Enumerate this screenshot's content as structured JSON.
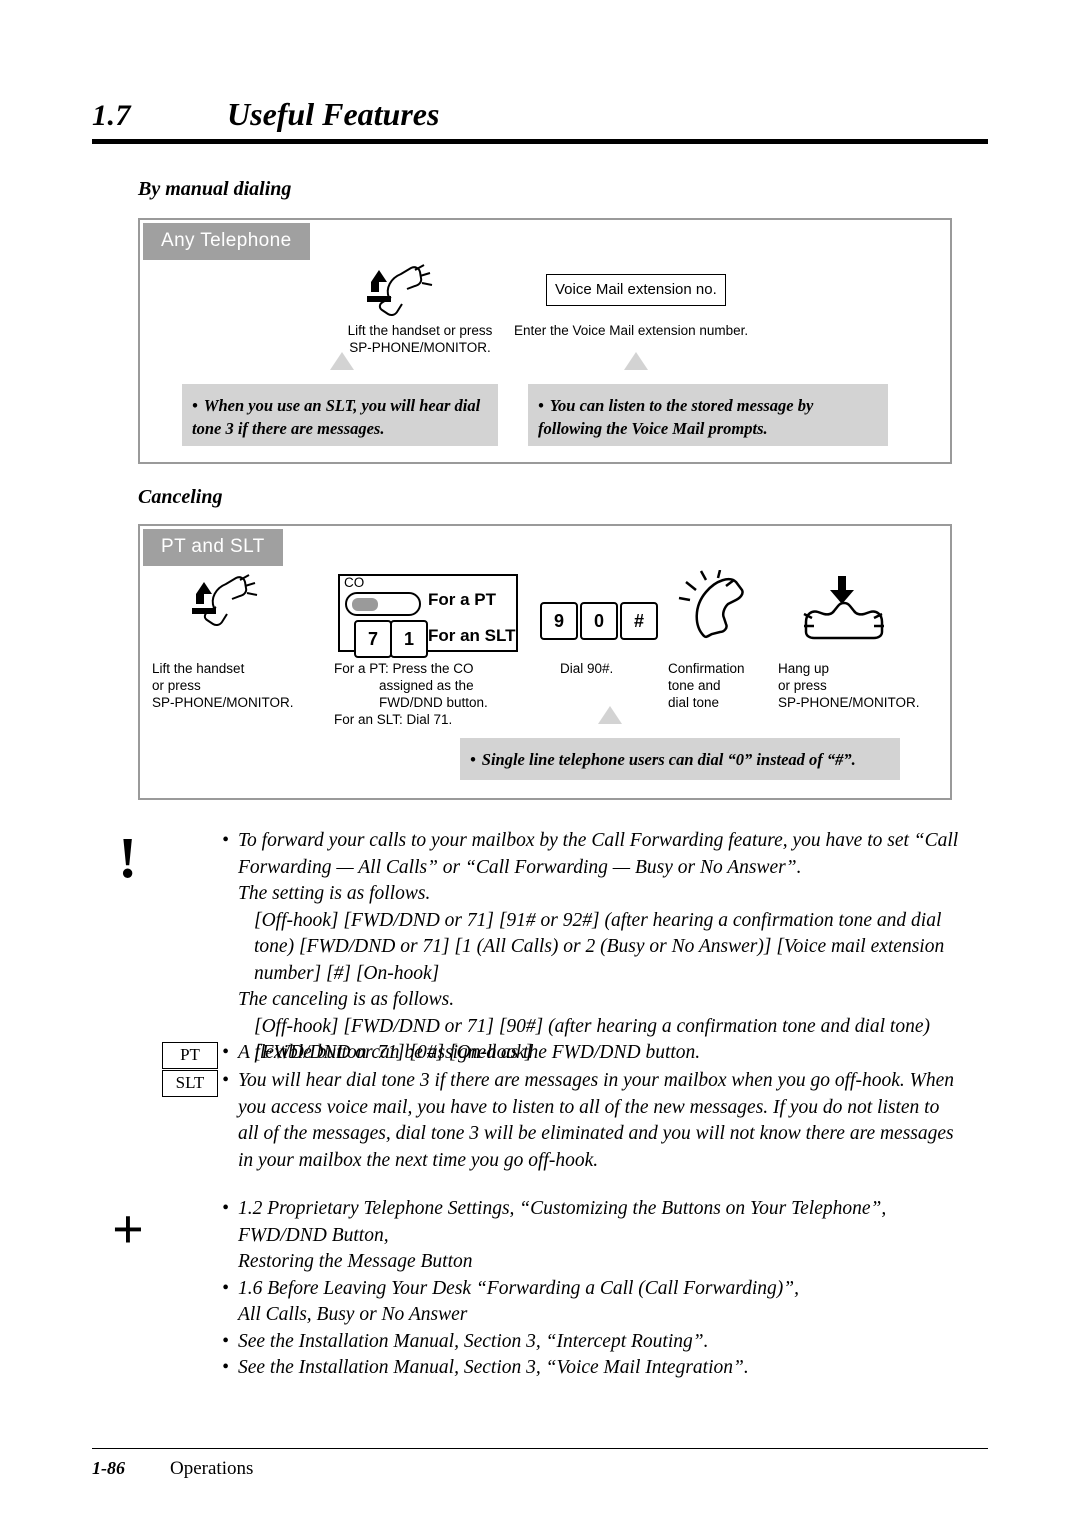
{
  "header": {
    "number": "1.7",
    "title": "Useful Features"
  },
  "sections": {
    "manual_dialing": {
      "heading": "By manual dialing",
      "tag": "Any Telephone",
      "steps": [
        {
          "caption": "Lift the handset or press\nSP-PHONE/MONITOR."
        },
        {
          "box_label": "Voice Mail extension no.",
          "caption": "Enter the Voice Mail extension number."
        }
      ],
      "notes": [
        "When you use an SLT, you will hear dial tone 3 if there are messages.",
        "You can listen to the stored message by following the Voice Mail prompts."
      ]
    },
    "canceling": {
      "heading": "Canceling",
      "tag": "PT and SLT",
      "for_a_pt": "For a PT",
      "for_an_slt": "For an SLT",
      "co_label": "CO",
      "slt_keys": [
        "7",
        "1"
      ],
      "dial_keys": [
        "9",
        "0",
        "#"
      ],
      "captions": [
        "Lift the handset\nor press\nSP-PHONE/MONITOR.",
        "For a PT: Press the CO\n          assigned as the\n          FWD/DND button.\nFor an SLT: Dial 71.",
        "Dial 90#.",
        "Confirmation\ntone and\ndial tone",
        "Hang up\nor press\nSP-PHONE/MONITOR."
      ],
      "note": "Single line telephone users can dial “0” instead of “#”."
    }
  },
  "caution": {
    "mark": "!",
    "items": [
      "To forward your calls to your mailbox by the Call Forwarding feature, you have to set “Call Forwarding — All Calls” or “Call Forwarding — Busy or No Answer”.",
      "The setting is as follows.",
      "[Off-hook] [FWD/DND or 71] [91# or 92#] (after hearing a confirmation tone and dial tone) [FWD/DND or 71] [1 (All Calls) or 2 (Busy or No Answer)] [Voice mail extension number] [#] [On-hook]",
      "The canceling is as follows.",
      "[Off-hook] [FWD/DND or 71] [90#] (after hearing a confirmation tone and dial tone) [FWD/DND or 71] [0#] [On-hook]"
    ],
    "pt_tag": "PT",
    "slt_tag": "SLT",
    "pt_text": "A flexible button can be assigned as the FWD/DND button.",
    "slt_text": "You will hear dial tone 3 if there are messages in your mailbox when you go off-hook. When you access voice mail, you have to listen to all of the new messages. If you do not listen to all of the messages, dial tone 3 will be eliminated and you will not know there are messages in your mailbox the next time you go off-hook."
  },
  "references": {
    "mark": "+",
    "items": [
      {
        "bullet": "•",
        "text": "1.2 Proprietary Telephone Settings, “Customizing the Buttons on Your Telephone”,"
      },
      {
        "bullet": "",
        "text": "FWD/DND Button,"
      },
      {
        "bullet": "",
        "text": "Restoring the Message Button"
      },
      {
        "bullet": "•",
        "text": "1.6 Before Leaving Your Desk “Forwarding a Call (Call Forwarding)”,"
      },
      {
        "bullet": "",
        "text": "All Calls, Busy or No Answer"
      },
      {
        "bullet": "•",
        "text": "See the Installation Manual, Section 3, “Intercept Routing”."
      },
      {
        "bullet": "•",
        "text": "See the Installation Manual, Section 3, “Voice Mail Integration”."
      }
    ]
  },
  "footer": {
    "page_number": "1-86",
    "label": "Operations"
  }
}
